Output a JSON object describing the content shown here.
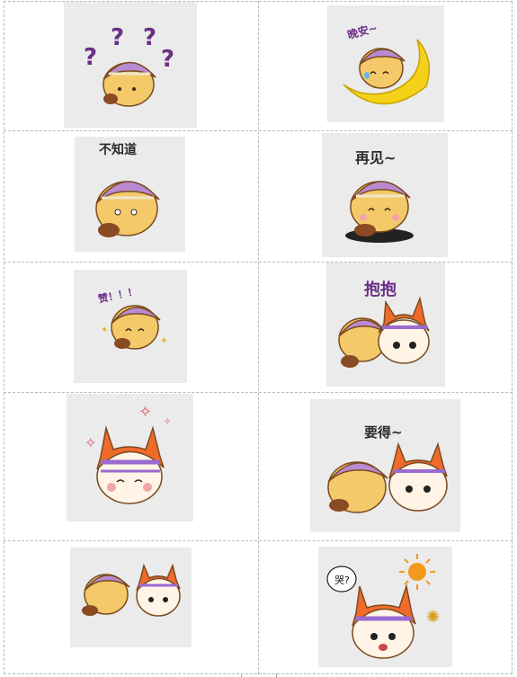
{
  "stickers": [
    {
      "id": "s1",
      "caption": ""
    },
    {
      "id": "s2",
      "caption": "晚安~"
    },
    {
      "id": "s3",
      "caption": "不知道"
    },
    {
      "id": "s4",
      "caption": "再见~"
    },
    {
      "id": "s5",
      "caption": "赞！！！"
    },
    {
      "id": "s6",
      "caption": "抱抱"
    },
    {
      "id": "s7",
      "caption": ""
    },
    {
      "id": "s8",
      "caption": "要得~"
    },
    {
      "id": "s9",
      "caption": ""
    },
    {
      "id": "s10",
      "caption": ""
    }
  ],
  "colors": {
    "sticker_bg": "#ebebeb",
    "bun_yellow": "#f4c96a",
    "hat_purple": "#b98ad1",
    "hat_stripe": "#f0e6c8",
    "horn_orange": "#ef6b2c",
    "moon_yellow": "#f5d21a",
    "caption_purple": "#6a2f86"
  },
  "icons": [
    "question-mark-icon",
    "moon-icon",
    "hole-icon",
    "sparkle-icon",
    "sun-icon",
    "speech-bubble-icon"
  ]
}
